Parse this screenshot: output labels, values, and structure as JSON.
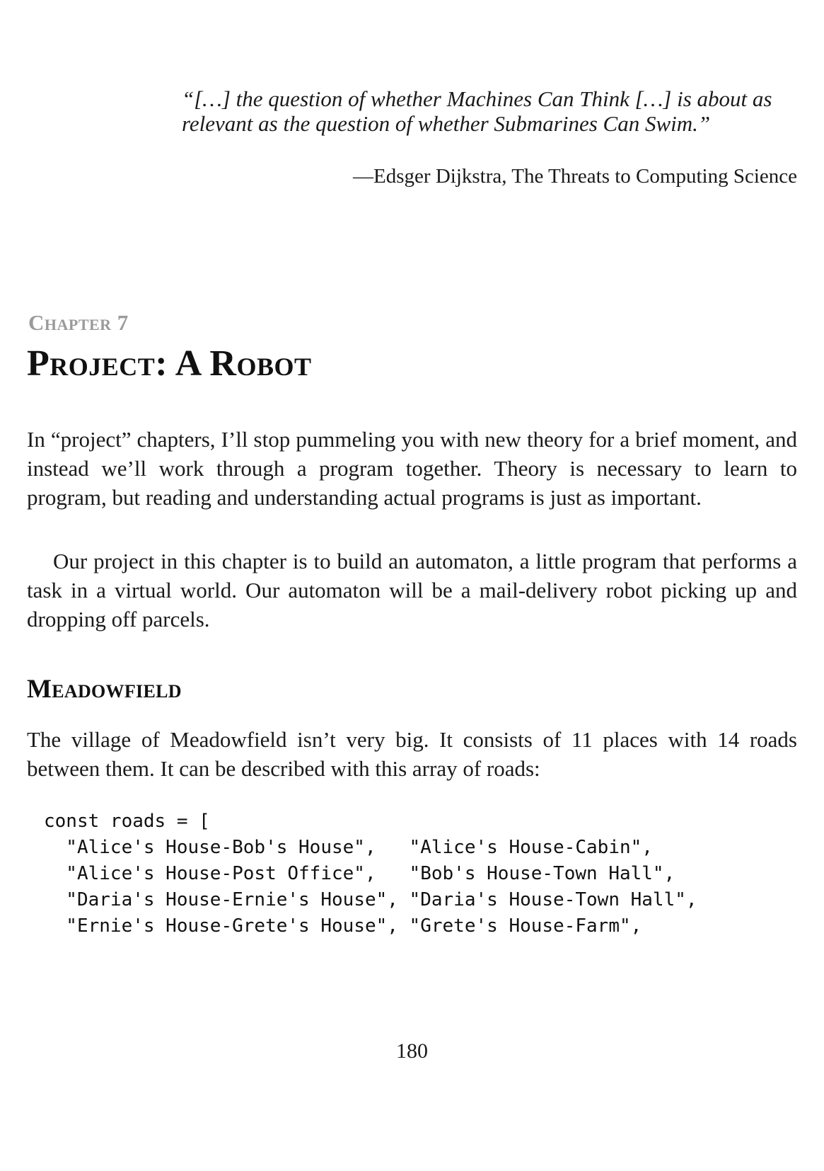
{
  "epigraph": {
    "quote": "“[…] the question of whether Machines Can Think […] is about as relevant as the question of whether Submarines Can Swim.”",
    "attribution": "—Edsger Dijkstra, The Threats to Computing Science"
  },
  "chapter": {
    "label": "Chapter 7",
    "title": "Project: A Robot"
  },
  "paragraphs": {
    "intro": "In “project” chapters, I’ll stop pummeling you with new theory for a brief moment, and instead we’ll work through a program together. Theory is necessary to learn to program, but reading and understanding actual programs is just as important.",
    "project": "Our project in this chapter is to build an automaton, a little program that performs a task in a virtual world. Our automaton will be a mail-delivery robot picking up and dropping off parcels."
  },
  "section": {
    "title": "Meadowfield",
    "text": "The village of Meadowfield isn’t very big. It consists of 11 places with 14 roads between them. It can be described with this array of roads:"
  },
  "code": {
    "lines": [
      "const roads = [",
      "  \"Alice's House-Bob's House\",   \"Alice's House-Cabin\",",
      "  \"Alice's House-Post Office\",   \"Bob's House-Town Hall\",",
      "  \"Daria's House-Ernie's House\", \"Daria's House-Town Hall\",",
      "  \"Ernie's House-Grete's House\", \"Grete's House-Farm\","
    ]
  },
  "page_number": "180"
}
